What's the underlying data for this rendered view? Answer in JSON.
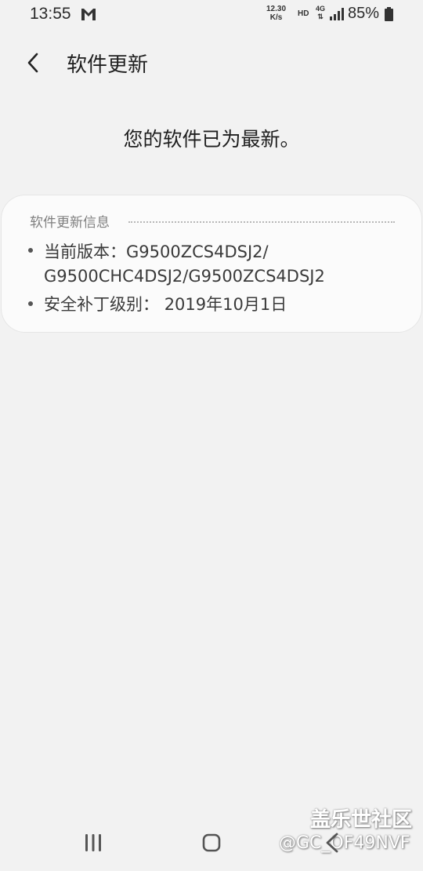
{
  "status_bar": {
    "time": "13:55",
    "network_speed_value": "12.30",
    "network_speed_unit": "K/s",
    "hd": "HD",
    "network_type": "4G",
    "battery": "85%",
    "icons": [
      "gmail-icon",
      "signal-icon",
      "battery-icon"
    ]
  },
  "header": {
    "title": "软件更新"
  },
  "main": {
    "status_message": "您的软件已为最新。"
  },
  "info_card": {
    "title": "软件更新信息",
    "current_version_label": "当前版本：",
    "current_version_line1": "G9500ZCS4DSJ2/",
    "current_version_line2": "G9500CHC4DSJ2/G9500ZCS4DSJ2",
    "security_patch_label": "安全补丁级别：",
    "security_patch_value": "2019年10月1日"
  },
  "watermark": {
    "title": "盖乐世社区",
    "handle": "@GC_OF49NVF"
  },
  "nav_bar": {
    "icons": [
      "recents-icon",
      "home-icon",
      "back-icon"
    ]
  },
  "colors": {
    "background": "#f2f2f2",
    "card": "#fbfbfb",
    "text_primary": "#1f1f1f",
    "text_secondary": "#7f7f7f"
  }
}
